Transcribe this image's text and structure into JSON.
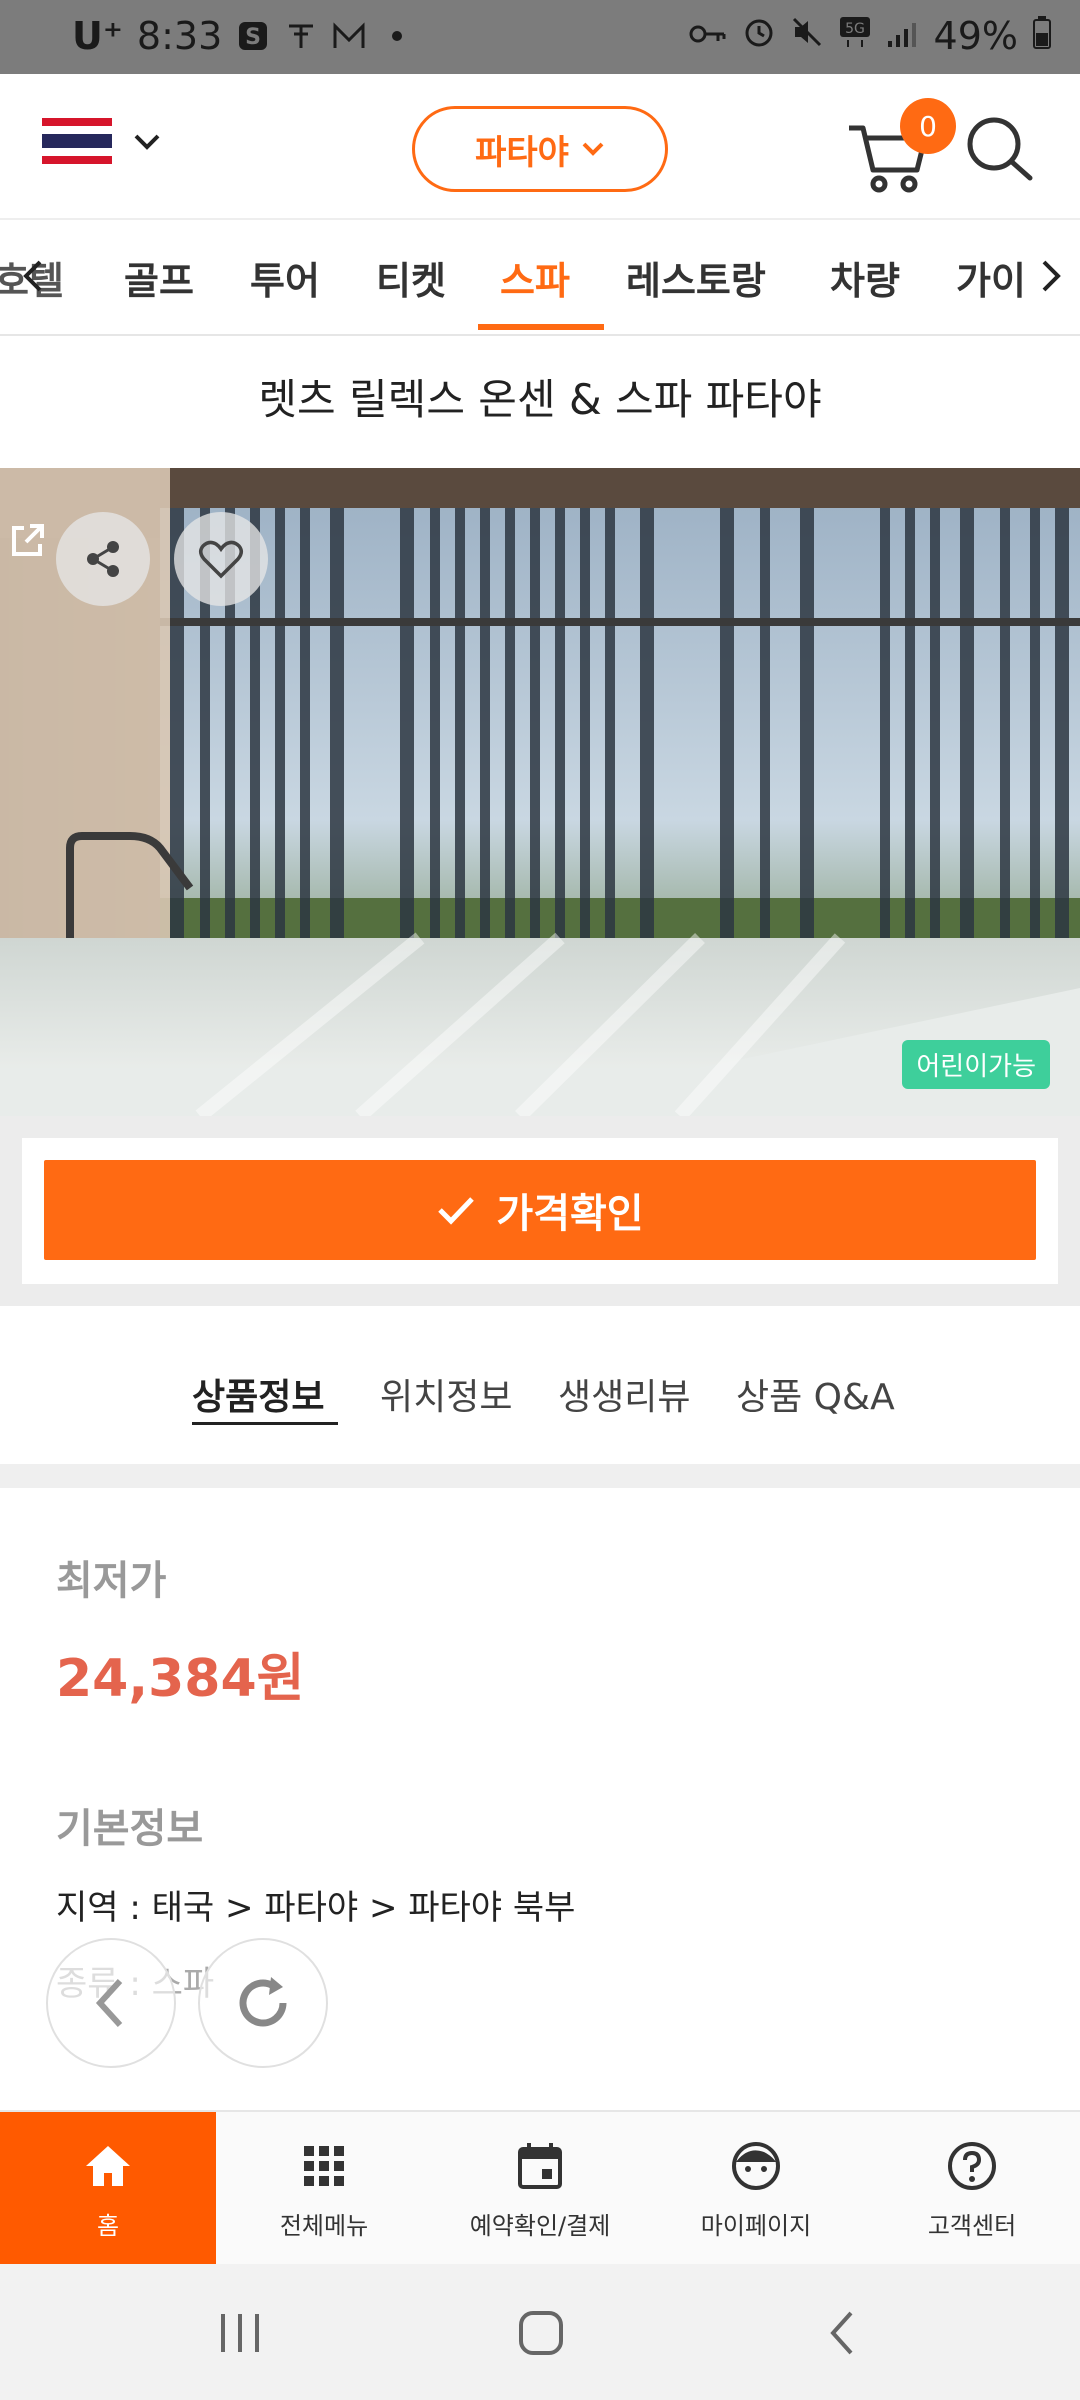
{
  "status_bar": {
    "carrier": "U⁺",
    "time": "8:33",
    "battery": "49%"
  },
  "header": {
    "region": "파타야",
    "cart_count": "0"
  },
  "categories": [
    {
      "label": "호텔"
    },
    {
      "label": "골프"
    },
    {
      "label": "투어"
    },
    {
      "label": "티켓"
    },
    {
      "label": "스파",
      "active": true
    },
    {
      "label": "레스토랑"
    },
    {
      "label": "차량"
    },
    {
      "label": "가이"
    }
  ],
  "product": {
    "title": "렛츠 릴렉스 온센 & 스파 파타야",
    "kids_badge": "어린이가능"
  },
  "cta": {
    "label": "가격확인"
  },
  "info_tabs": [
    {
      "label": "상품정보",
      "active": true
    },
    {
      "label": "위치정보"
    },
    {
      "label": "생생리뷰"
    },
    {
      "label": "상품 Q&A"
    }
  ],
  "content": {
    "lowest_price_label": "최저가",
    "lowest_price": "24,384원",
    "basic_info_label": "기본정보",
    "region_line": "지역 : 태국 > 파타야 > 파타야 북부",
    "type_line": "종류 : 스파"
  },
  "bottom_nav": [
    {
      "label": "홈",
      "icon": "home-icon",
      "active": true
    },
    {
      "label": "전체메뉴",
      "icon": "grid-icon"
    },
    {
      "label": "예약확인/결제",
      "icon": "calendar-icon"
    },
    {
      "label": "마이페이지",
      "icon": "face-icon"
    },
    {
      "label": "고객센터",
      "icon": "help-icon"
    }
  ],
  "colors": {
    "accent": "#ff6a13",
    "price": "#e4644d",
    "kids_badge": "#3ecf9b"
  }
}
